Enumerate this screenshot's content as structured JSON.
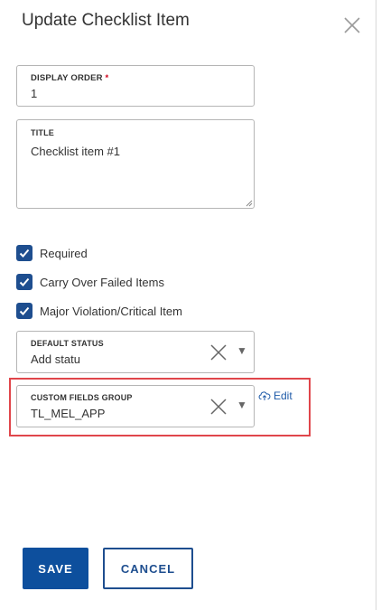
{
  "dialog": {
    "title": "Update Checklist Item"
  },
  "fields": {
    "display_order": {
      "label": "DISPLAY ORDER",
      "required_mark": "*",
      "value": "1"
    },
    "title": {
      "label": "TITLE",
      "value": "Checklist item #1"
    }
  },
  "checkboxes": [
    {
      "label": "Required",
      "checked": true
    },
    {
      "label": "Carry Over Failed Items",
      "checked": true
    },
    {
      "label": "Major Violation/Critical Item",
      "checked": true
    }
  ],
  "default_status": {
    "label": "DEFAULT STATUS",
    "value": "Add statu"
  },
  "custom_fields_group": {
    "label": "CUSTOM FIELDS GROUP",
    "value": "TL_MEL_APP",
    "edit_label": "Edit"
  },
  "buttons": {
    "save": "SAVE",
    "cancel": "CANCEL"
  },
  "colors": {
    "accent": "#0d4f9d",
    "checkbox": "#1e4e8f",
    "highlight": "#e0464b",
    "link": "#1e5aa8"
  },
  "icons": {
    "close": "close-icon",
    "clear": "clear-icon",
    "dropdown": "caret-down-icon",
    "edit": "cloud-upload-icon"
  }
}
